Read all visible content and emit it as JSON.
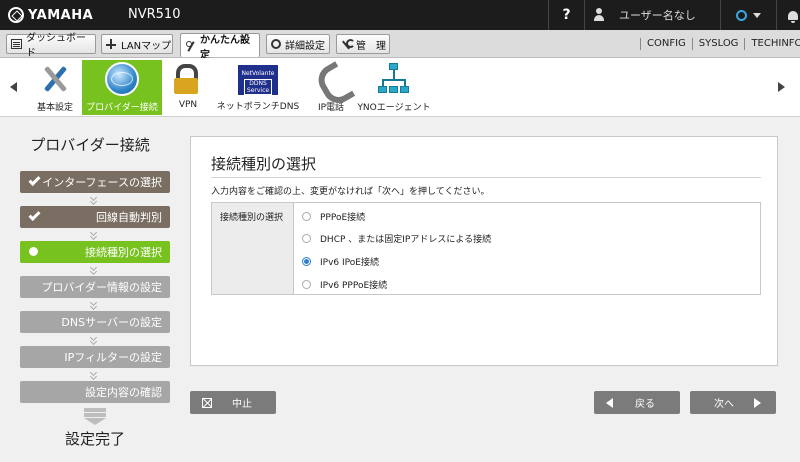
{
  "topbar": {
    "brand": "YAMAHA",
    "model": "NVR510",
    "help": "?",
    "user": "ユーザー名なし"
  },
  "menubar": {
    "buttons": [
      {
        "label": "ダッシュボード",
        "icon": "dashboard-icon"
      },
      {
        "label": "LANマップ",
        "icon": "lan-map-icon"
      },
      {
        "label": "かんたん設定",
        "icon": "wizard-icon"
      },
      {
        "label": "詳細設定",
        "icon": "gear-icon"
      },
      {
        "label": "管　理",
        "icon": "tools-icon"
      }
    ],
    "links": [
      "CONFIG",
      "SYSLOG",
      "TECHINFO"
    ]
  },
  "iconbar": {
    "items": [
      {
        "label": "基本設定",
        "icon": "tools-icon"
      },
      {
        "label": "プロバイダー接続",
        "icon": "globe-icon"
      },
      {
        "label": "VPN",
        "icon": "lock-icon"
      },
      {
        "label": "ネットボランチDNS",
        "icon": "ddns-icon"
      },
      {
        "label": "IP電話",
        "icon": "phone-icon"
      },
      {
        "label": "YNOエージェント",
        "icon": "network-icon"
      }
    ],
    "ddns_badge": {
      "line1": "NetVolante",
      "line2": "DDNS",
      "line3": "Service"
    }
  },
  "sidebar": {
    "title": "プロバイダー接続",
    "steps": [
      {
        "label": "インターフェースの選択",
        "state": "done"
      },
      {
        "label": "回線自動判別",
        "state": "done"
      },
      {
        "label": "接続種別の選択",
        "state": "current"
      },
      {
        "label": "プロバイダー情報の設定",
        "state": "pending"
      },
      {
        "label": "DNSサーバーの設定",
        "state": "pending"
      },
      {
        "label": "IPフィルターの設定",
        "state": "pending"
      },
      {
        "label": "設定内容の確認",
        "state": "pending"
      }
    ],
    "final": "設定完了"
  },
  "main": {
    "title": "接続種別の選択",
    "description": "入力内容をご確認の上、変更がなければ「次へ」を押してください。",
    "field_label": "接続種別の選択",
    "options": [
      {
        "label": "PPPoE接続",
        "selected": false
      },
      {
        "label": "DHCP 、または固定IPアドレスによる接続",
        "selected": false
      },
      {
        "label": "IPv6 IPoE接続",
        "selected": true
      },
      {
        "label": "IPv6 PPPoE接続",
        "selected": false
      }
    ]
  },
  "buttons": {
    "cancel": "中止",
    "back": "戻る",
    "next": "次へ"
  },
  "colors": {
    "accent_green": "#78c21f",
    "done_step": "#7a6e63",
    "pending_step": "#a6a6a6",
    "topbar": "#1c1c1c"
  }
}
